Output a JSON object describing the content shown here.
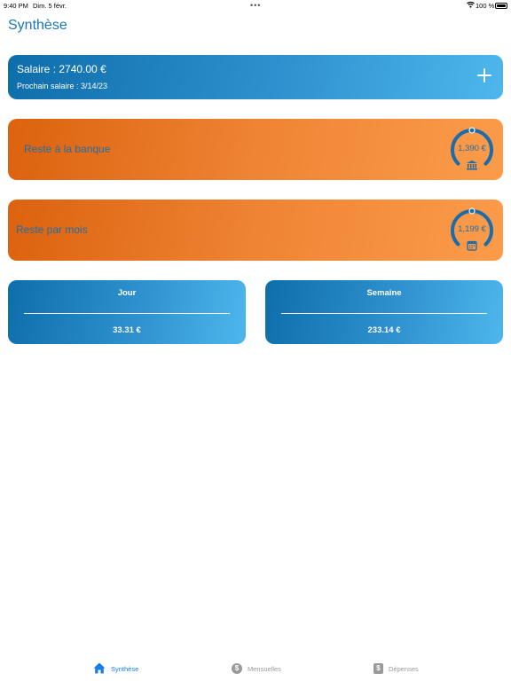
{
  "status_bar": {
    "time": "9:40 PM",
    "date": "Dim. 5 févr.",
    "battery": "100 %"
  },
  "page": {
    "title": "Synthèse"
  },
  "salary": {
    "label": "Salaire : 2740.00 €",
    "next_label": "Prochain salaire :  3/14/23"
  },
  "bank": {
    "label": "Reste à la banque",
    "gauge_value": "1,390 €",
    "gauge_fraction": 0.75,
    "icon": "bank-icon"
  },
  "monthly": {
    "label": "Reste par mois",
    "gauge_value": "1,199 €",
    "gauge_fraction": 0.75,
    "icon": "calendar-icon"
  },
  "day": {
    "title": "Jour",
    "value": "33.31 €"
  },
  "week": {
    "title": "Semaine",
    "value": "233.14 €"
  },
  "tabs": [
    {
      "label": "Synthèse",
      "icon": "home-icon",
      "active": true
    },
    {
      "label": "Mensuelles",
      "icon": "dollar-circle-icon",
      "active": false
    },
    {
      "label": "Dépenses",
      "icon": "dollar-doc-icon",
      "active": false
    }
  ],
  "colors": {
    "accent": "#1a77b3",
    "tab_active": "#1a7ce8",
    "orange": "#ee8434",
    "blue": "#2f91cf"
  }
}
